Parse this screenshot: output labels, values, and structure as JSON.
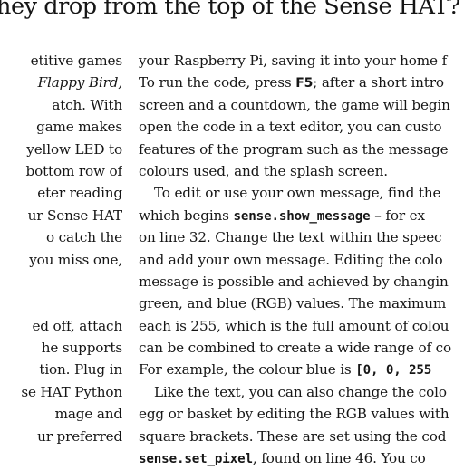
{
  "heading": "hey drop from the top of the Sense HAT?",
  "left_column": [
    "etitive games",
    "Flappy Bird,",
    "atch. With",
    "game makes",
    "yellow LED to",
    "bottom row of",
    "eter reading",
    "ur Sense HAT",
    "o catch the",
    "you miss one,",
    "",
    "",
    "ed off, attach",
    "he supports",
    "tion. Plug in",
    "se HAT Python",
    "mage and",
    "ur preferred"
  ],
  "right_column": [
    {
      "parts": [
        {
          "t": "your Raspberry Pi, saving it into your home f"
        }
      ]
    },
    {
      "parts": [
        {
          "t": "To run the code, press "
        },
        {
          "t": "F5",
          "key": true
        },
        {
          "t": "; after a short intro"
        }
      ]
    },
    {
      "parts": [
        {
          "t": "screen and a countdown, the game will begin"
        }
      ]
    },
    {
      "parts": [
        {
          "t": "open the code in a text editor, you can custo"
        }
      ]
    },
    {
      "parts": [
        {
          "t": "features of the program such as the message"
        }
      ]
    },
    {
      "parts": [
        {
          "t": "colours used, and the splash screen."
        }
      ]
    },
    {
      "indent": true,
      "parts": [
        {
          "t": "To edit or use your own message, find the"
        }
      ]
    },
    {
      "parts": [
        {
          "t": "which begins "
        },
        {
          "t": "sense.show_message",
          "code": true
        },
        {
          "t": " – for ex"
        }
      ]
    },
    {
      "parts": [
        {
          "t": "on line 32. Change the text within the speec"
        }
      ]
    },
    {
      "parts": [
        {
          "t": "and add your own message. Editing the colo"
        }
      ]
    },
    {
      "parts": [
        {
          "t": "message is possible and achieved by changin"
        }
      ]
    },
    {
      "parts": [
        {
          "t": "green, and blue (RGB) values. The maximum"
        }
      ]
    },
    {
      "parts": [
        {
          "t": "each is 255, which is the full amount of colou"
        }
      ]
    },
    {
      "parts": [
        {
          "t": "can be combined to create a wide range of co"
        }
      ]
    },
    {
      "parts": [
        {
          "t": "For example, the colour blue is "
        },
        {
          "t": "[0, 0, 255",
          "code": true
        }
      ]
    },
    {
      "indent": true,
      "parts": [
        {
          "t": "Like the text, you can also change the colo"
        }
      ]
    },
    {
      "parts": [
        {
          "t": "egg or basket by editing the RGB values with"
        }
      ]
    },
    {
      "parts": [
        {
          "t": "square brackets. These are set using the cod"
        }
      ]
    },
    {
      "parts": [
        {
          "t": "sense.set_pixel",
          "code": true
        },
        {
          "t": ", found on line 46. You co"
        }
      ]
    }
  ]
}
